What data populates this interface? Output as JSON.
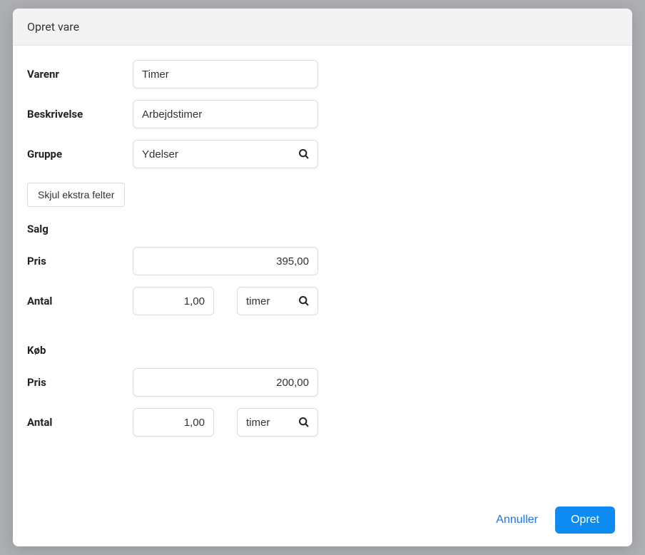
{
  "modal": {
    "title": "Opret vare"
  },
  "fields": {
    "itemno_label": "Varenr",
    "itemno_value": "Timer",
    "description_label": "Beskrivelse",
    "description_value": "Arbejdstimer",
    "group_label": "Gruppe",
    "group_value": "Ydelser"
  },
  "toggle": {
    "label": "Skjul ekstra felter"
  },
  "sales": {
    "heading": "Salg",
    "price_label": "Pris",
    "price_value": "395,00",
    "qty_label": "Antal",
    "qty_value": "1,00",
    "unit_value": "timer"
  },
  "purchase": {
    "heading": "Køb",
    "price_label": "Pris",
    "price_value": "200,00",
    "qty_label": "Antal",
    "qty_value": "1,00",
    "unit_value": "timer"
  },
  "footer": {
    "cancel": "Annuller",
    "submit": "Opret"
  }
}
